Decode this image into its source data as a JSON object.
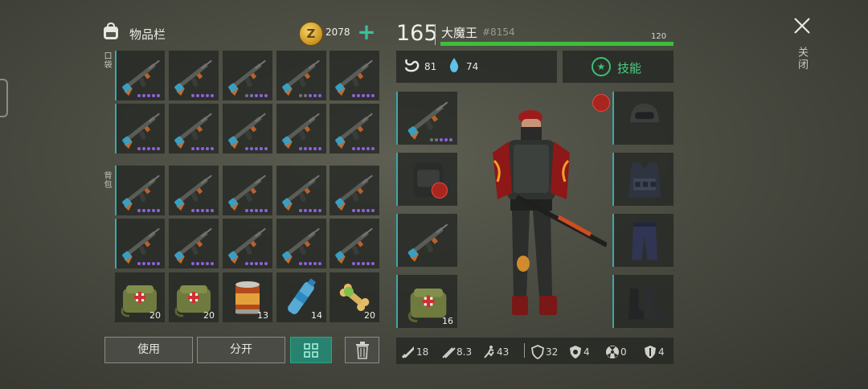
{
  "inventory": {
    "title": "物品栏",
    "coins": "2078",
    "add_coins": "+",
    "pocket_label": "口袋",
    "backpack_label": "背包",
    "pocket_slots": [
      {
        "item": "rifle",
        "dots": 5,
        "gray": 0
      },
      {
        "item": "rifle",
        "dots": 5,
        "gray": 0
      },
      {
        "item": "rifle",
        "dots": 5,
        "gray": 1
      },
      {
        "item": "rifle",
        "dots": 5,
        "gray": 2
      },
      {
        "item": "rifle",
        "dots": 5,
        "gray": 0
      },
      {
        "item": "rifle",
        "dots": 5,
        "gray": 0
      },
      {
        "item": "rifle",
        "dots": 5,
        "gray": 0
      },
      {
        "item": "rifle",
        "dots": 5,
        "gray": 0
      },
      {
        "item": "rifle",
        "dots": 5,
        "gray": 0
      },
      {
        "item": "rifle",
        "dots": 5,
        "gray": 0
      }
    ],
    "backpack_slots": [
      {
        "item": "rifle",
        "dots": 5,
        "gray": 0
      },
      {
        "item": "rifle",
        "dots": 5,
        "gray": 0
      },
      {
        "item": "rifle",
        "dots": 5,
        "gray": 0
      },
      {
        "item": "rifle",
        "dots": 5,
        "gray": 0
      },
      {
        "item": "rifle",
        "dots": 5,
        "gray": 0
      },
      {
        "item": "rifle",
        "dots": 5,
        "gray": 0
      },
      {
        "item": "rifle",
        "dots": 5,
        "gray": 0
      },
      {
        "item": "rifle",
        "dots": 5,
        "gray": 0
      },
      {
        "item": "rifle",
        "dots": 5,
        "gray": 0
      },
      {
        "item": "rifle",
        "dots": 5,
        "gray": 0
      }
    ],
    "supply_slots": [
      {
        "item": "medkit",
        "count": "20"
      },
      {
        "item": "medkit",
        "count": "20"
      },
      {
        "item": "canned-food",
        "count": "13"
      },
      {
        "item": "water-bottle",
        "count": "14"
      },
      {
        "item": "bone",
        "count": "20"
      }
    ]
  },
  "buttons": {
    "use": "使用",
    "split": "分开"
  },
  "player": {
    "level": "165",
    "name": "大魔王",
    "id": "#8154",
    "hp": "120",
    "hp_fraction": 1.0,
    "food": "81",
    "water": "74",
    "skills_label": "技能"
  },
  "equipment": {
    "left": [
      {
        "item": "rifle",
        "dots": 5,
        "gray": 2
      },
      {
        "item": "backpack"
      },
      {
        "item": "rifle",
        "dots": 0
      },
      {
        "item": "medkit",
        "count": "16"
      }
    ],
    "right": [
      "helmet",
      "vest",
      "pants",
      "boots"
    ]
  },
  "stats": [
    {
      "icon": "melee-icon",
      "value": "18"
    },
    {
      "icon": "damage-icon",
      "value": "8.3"
    },
    {
      "icon": "speed-icon",
      "value": "43"
    },
    {
      "icon": "armor-icon",
      "value": "32"
    },
    {
      "icon": "bio-icon",
      "value": "4"
    },
    {
      "icon": "radiation-icon",
      "value": "0"
    },
    {
      "icon": "shield-icon",
      "value": "4"
    }
  ],
  "close_label": "关闭",
  "colors": {
    "accent": "#3fa7a8",
    "hp": "#3cbf3c",
    "skill": "#4ccf85",
    "dots": "#8d63d8"
  }
}
